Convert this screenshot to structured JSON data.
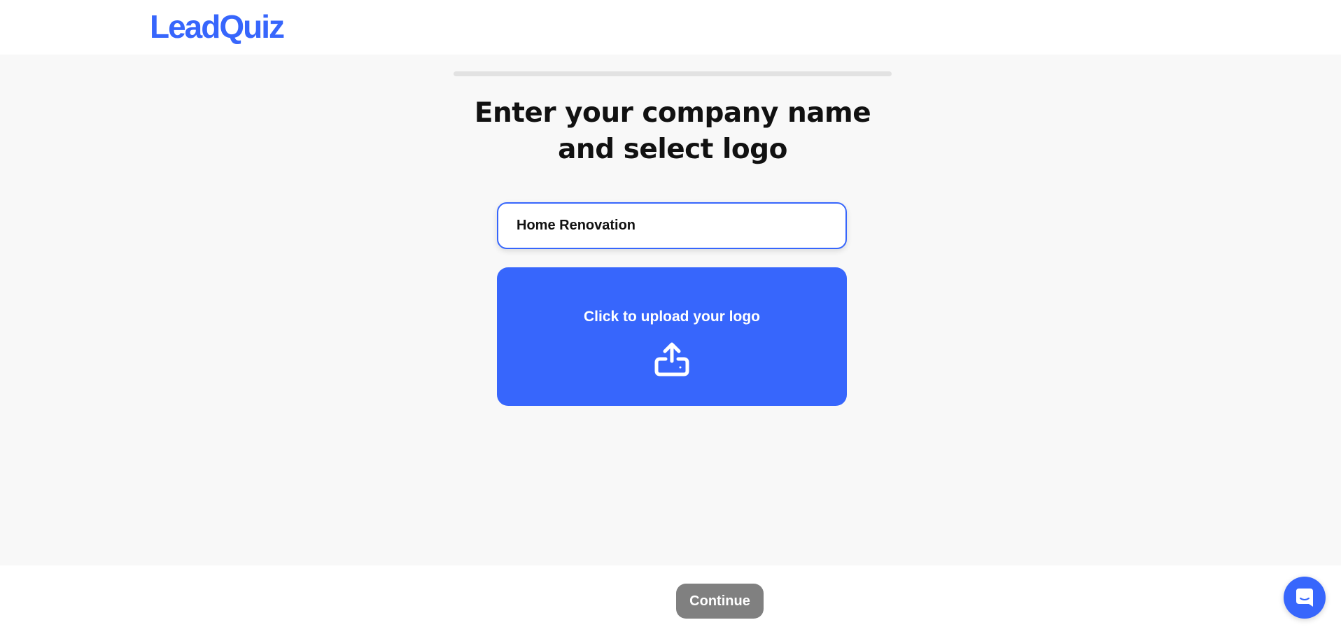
{
  "brand": {
    "name": "LeadQuiz",
    "color": "#3766fc"
  },
  "progress": {
    "value": 0
  },
  "title": {
    "line1": "Enter your company name",
    "line2": "and select logo"
  },
  "company_name": {
    "value": "Home Renovation",
    "placeholder": ""
  },
  "upload": {
    "label": "Click to upload your logo",
    "icon": "upload-icon"
  },
  "footer": {
    "continue_label": "Continue",
    "continue_color": "#808080",
    "chat_icon": "chat-icon"
  }
}
